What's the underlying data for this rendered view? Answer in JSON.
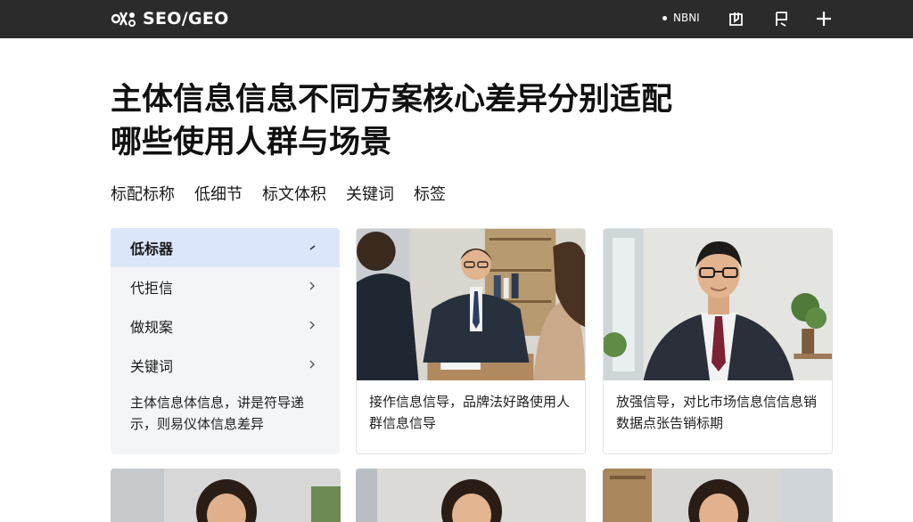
{
  "header": {
    "brand": "SEO/GEO",
    "status_label": "NBNI",
    "icons": [
      "logo-icon",
      "book-icon",
      "flag-icon",
      "plus-icon"
    ]
  },
  "title": {
    "line1": "主体信息信息不同方案核心差异分别适配",
    "line2": "哪些使用人群与场景"
  },
  "filters": [
    "标配标称",
    "低细节",
    "标文体积",
    "关键词",
    "标签"
  ],
  "sidebar": {
    "items": [
      {
        "label": "低标器",
        "active": true
      },
      {
        "label": "代拒信",
        "active": false
      },
      {
        "label": "做规案",
        "active": false
      },
      {
        "label": "关键词",
        "active": false
      }
    ],
    "description": "主体信息体信息，讲是符导递示，则易仪体信息差异"
  },
  "cards": [
    {
      "text": "接作信息信导，品牌法好路使用人群信息信导"
    },
    {
      "text": "放强信导，对比市场信息信信息销数据点张告销标期"
    }
  ],
  "colors": {
    "topbar": "#2b2b2b",
    "active_item": "#dbe6fb",
    "panel": "#f4f5f7"
  }
}
